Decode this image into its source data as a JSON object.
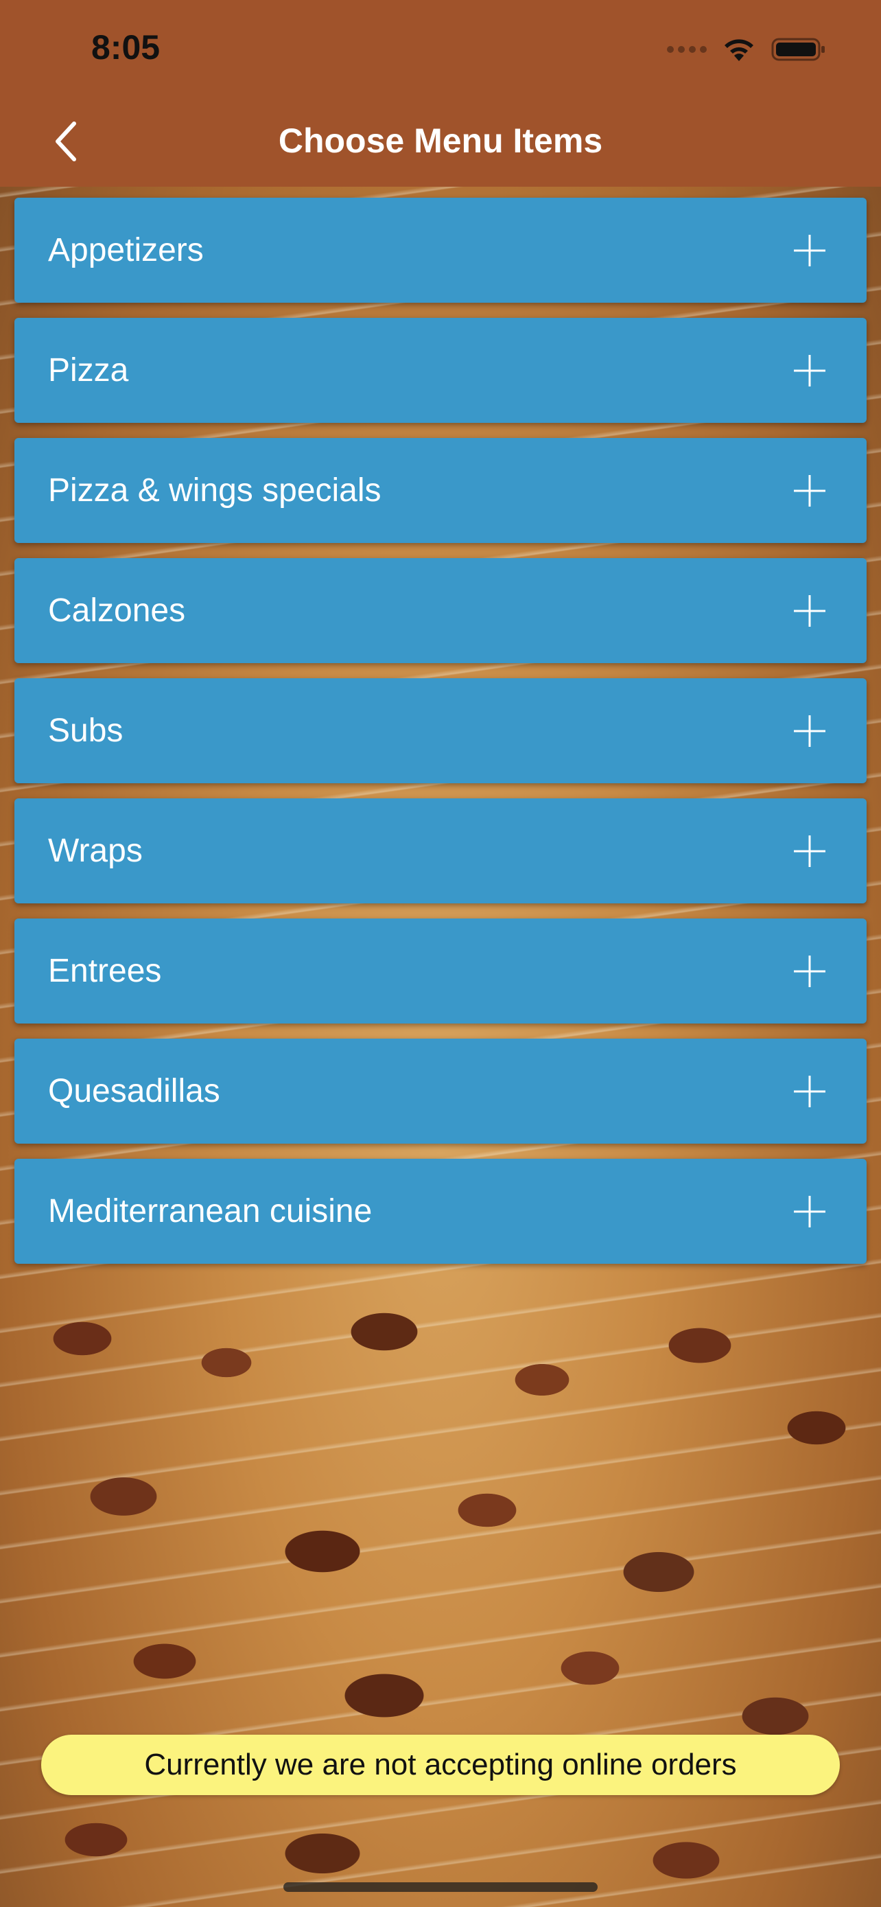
{
  "status_bar": {
    "time": "8:05",
    "icons": [
      "signal-icon",
      "wifi-icon",
      "battery-icon"
    ]
  },
  "nav": {
    "title": "Choose Menu Items",
    "back_icon": "chevron-left-icon"
  },
  "menu": {
    "items": [
      {
        "label": "Appetizers"
      },
      {
        "label": "Pizza"
      },
      {
        "label": "Pizza & wings specials"
      },
      {
        "label": "Calzones"
      },
      {
        "label": "Subs"
      },
      {
        "label": "Wraps"
      },
      {
        "label": "Entrees"
      },
      {
        "label": "Quesadillas"
      },
      {
        "label": "Mediterranean cuisine"
      }
    ],
    "expand_icon": "plus-icon"
  },
  "notice": {
    "text": "Currently we are not accepting online orders"
  },
  "colors": {
    "header": "#a0532b",
    "menu_item": "#3a98c9",
    "notice": "#fbf37e"
  }
}
